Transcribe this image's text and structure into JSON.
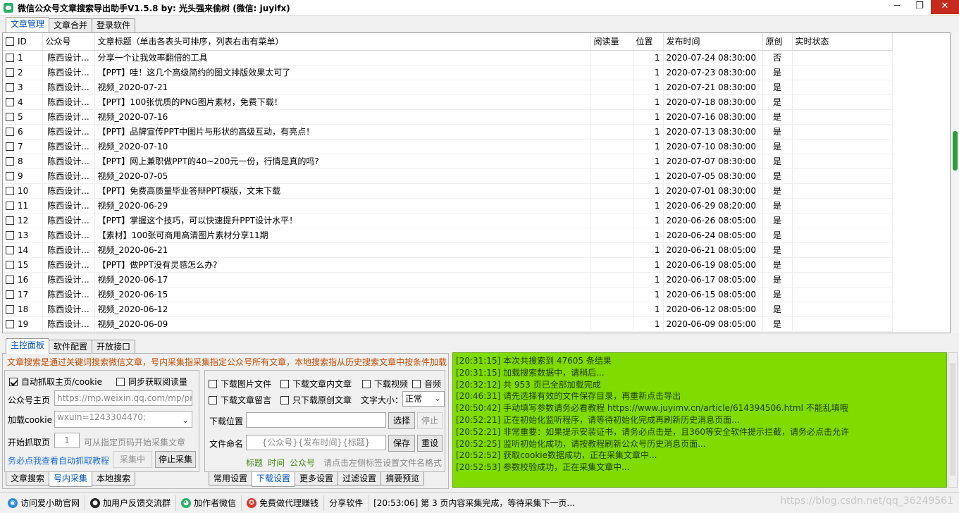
{
  "window": {
    "title": "微信公众号文章搜索导出助手V1.5.8   by:  光头强来偷树  (微信:  juyifx)",
    "minimize": "─",
    "restore": "❐",
    "close": "✕"
  },
  "top_tabs": [
    {
      "label": "文章管理"
    },
    {
      "label": "文章合并"
    },
    {
      "label": "登录软件"
    }
  ],
  "grid": {
    "headers": {
      "id": "ID",
      "account": "公众号",
      "title": "文章标题（单击各表头可排序，列表右击有菜单）",
      "reads": "阅读量",
      "position": "位置",
      "date": "发布时间",
      "original": "原创",
      "status": "实时状态"
    },
    "rows": [
      {
        "id": "1",
        "account": "陈西设计...",
        "title": "分享一个让我效率翻倍的工具",
        "reads": "",
        "position": "1",
        "date": "2020-07-24 08:30:00",
        "original": "否",
        "status": ""
      },
      {
        "id": "2",
        "account": "陈西设计...",
        "title": "【PPT】哇！这几个高级简约的图文排版效果太可了",
        "reads": "",
        "position": "1",
        "date": "2020-07-23 08:30:00",
        "original": "是",
        "status": ""
      },
      {
        "id": "3",
        "account": "陈西设计...",
        "title": "视频_2020-07-21",
        "reads": "",
        "position": "1",
        "date": "2020-07-21 08:30:00",
        "original": "是",
        "status": ""
      },
      {
        "id": "4",
        "account": "陈西设计...",
        "title": "【PPT】100张优质的PNG图片素材，免费下载！",
        "reads": "",
        "position": "1",
        "date": "2020-07-18 08:30:00",
        "original": "是",
        "status": ""
      },
      {
        "id": "5",
        "account": "陈西设计...",
        "title": "视频_2020-07-16",
        "reads": "",
        "position": "1",
        "date": "2020-07-16 08:30:00",
        "original": "是",
        "status": ""
      },
      {
        "id": "6",
        "account": "陈西设计...",
        "title": "【PPT】品牌宣传PPT中图片与形状的高级互动，有亮点！",
        "reads": "",
        "position": "1",
        "date": "2020-07-13 08:30:00",
        "original": "是",
        "status": ""
      },
      {
        "id": "7",
        "account": "陈西设计...",
        "title": "视频_2020-07-10",
        "reads": "",
        "position": "1",
        "date": "2020-07-10 08:30:00",
        "original": "是",
        "status": ""
      },
      {
        "id": "8",
        "account": "陈西设计...",
        "title": "【PPT】网上兼职做PPT的40~200元一份，行情是真的吗?",
        "reads": "",
        "position": "1",
        "date": "2020-07-07 08:30:00",
        "original": "是",
        "status": ""
      },
      {
        "id": "9",
        "account": "陈西设计...",
        "title": "视频_2020-07-05",
        "reads": "",
        "position": "1",
        "date": "2020-07-05 08:30:00",
        "original": "是",
        "status": ""
      },
      {
        "id": "10",
        "account": "陈西设计...",
        "title": "【PPT】免费高质量毕业答辩PPT模版，文末下载",
        "reads": "",
        "position": "1",
        "date": "2020-07-01 08:30:00",
        "original": "是",
        "status": ""
      },
      {
        "id": "11",
        "account": "陈西设计...",
        "title": "视频_2020-06-29",
        "reads": "",
        "position": "1",
        "date": "2020-06-29 08:20:00",
        "original": "是",
        "status": ""
      },
      {
        "id": "12",
        "account": "陈西设计...",
        "title": "【PPT】掌握这个技巧，可以快速提升PPT设计水平！",
        "reads": "",
        "position": "1",
        "date": "2020-06-26 08:05:00",
        "original": "是",
        "status": ""
      },
      {
        "id": "13",
        "account": "陈西设计...",
        "title": "【素材】100张可商用高清图片素材分享11期",
        "reads": "",
        "position": "1",
        "date": "2020-06-24 08:05:00",
        "original": "是",
        "status": ""
      },
      {
        "id": "14",
        "account": "陈西设计...",
        "title": "视频_2020-06-21",
        "reads": "",
        "position": "1",
        "date": "2020-06-21 08:05:00",
        "original": "是",
        "status": ""
      },
      {
        "id": "15",
        "account": "陈西设计...",
        "title": "【PPT】做PPT没有灵感怎么办?",
        "reads": "",
        "position": "1",
        "date": "2020-06-19 08:05:00",
        "original": "是",
        "status": ""
      },
      {
        "id": "16",
        "account": "陈西设计...",
        "title": "视频_2020-06-17",
        "reads": "",
        "position": "1",
        "date": "2020-06-17 08:05:00",
        "original": "是",
        "status": ""
      },
      {
        "id": "17",
        "account": "陈西设计...",
        "title": "视频_2020-06-15",
        "reads": "",
        "position": "1",
        "date": "2020-06-15 08:05:00",
        "original": "是",
        "status": ""
      },
      {
        "id": "18",
        "account": "陈西设计...",
        "title": "视频_2020-06-12",
        "reads": "",
        "position": "1",
        "date": "2020-06-12 08:05:00",
        "original": "是",
        "status": ""
      },
      {
        "id": "19",
        "account": "陈西设计...",
        "title": "视频_2020-06-09",
        "reads": "",
        "position": "1",
        "date": "2020-06-09 08:05:00",
        "original": "是",
        "status": ""
      }
    ]
  },
  "mid_tabs": [
    {
      "label": "主控面板"
    },
    {
      "label": "软件配置"
    },
    {
      "label": "开放接口"
    }
  ],
  "panel": {
    "note": "文章搜索是通过关键词搜索微信文章，号内采集指采集指定公众号所有文章，本地搜索指从历史搜索文章中按条件加载",
    "auto_cookie": "自动抓取主页/cookie",
    "sync_reads": "同步获取阅读量",
    "homepage_label": "公众号主页",
    "homepage_value": "https://mp.weixin.qq.com/mp/profile_ext",
    "cookie_label": "加载cookie",
    "cookie_value": "wxuin=1243304470;",
    "start_page_label": "开始抓取页",
    "start_page_value": "1",
    "start_page_hint": "可从指定页码开始采集文章",
    "tutorial_link": "务必点我查看自动抓取教程",
    "collecting": "采集中",
    "stop_btn": "停止采集",
    "download_images": "下载图片文件",
    "download_inner": "下载文章内文章",
    "download_video": "下载视频",
    "audio": "音频",
    "download_comments": "下载文章留言",
    "original_only": "只下载原创文章",
    "font_size_label": "文字大小：",
    "font_size_value": "正常",
    "download_pos_label": "下载位置",
    "select_btn": "选择",
    "stop_small": "停止",
    "file_naming_label": "文件命名",
    "file_naming_value": "{公众号}{发布时间}{标题}",
    "save_btn": "保存",
    "reset_btn": "重设",
    "tag_title": "标题",
    "tag_time": "时间",
    "tag_account": "公众号",
    "tag_hint": "请点击左侧标签设置文件名格式"
  },
  "left_bottom_tabs": [
    {
      "label": "文章搜索"
    },
    {
      "label": "号内采集"
    },
    {
      "label": "本地搜索"
    }
  ],
  "right_bottom_tabs": [
    {
      "label": "常用设置"
    },
    {
      "label": "下载设置"
    },
    {
      "label": "更多设置"
    },
    {
      "label": "过滤设置"
    },
    {
      "label": "摘要预览"
    }
  ],
  "log": [
    "[20:31:15] 本次共搜索到 47605 条结果",
    "[20:31:15] 加载搜索数据中，请稍后...",
    "[20:32:12] 共 953 页已全部加载完成",
    "[20:46:31] 请先选择有效的文件保存目录，再重新点击导出",
    "[20:50:42] 手动填写参数请务必看教程 https://www.juyimv.cn/article/614394506.html 不能乱填哦",
    "[20:52:21] 正在初始化监听程序，请等待初始化完成再刷新历史消息页面...",
    "[20:52:21] 非常重要：如果提示安装证书，请务必点击是，且360等安全软件提示拦截，请务必点击允许",
    "[20:52:25] 监听初始化成功，请按教程刷新公众号历史消息页面...",
    "[20:52:52] 获取cookie数据成功，正在采集文章中...",
    "[20:52:53] 参数校验成功，正在采集文章中..."
  ],
  "statusbar": {
    "site": "访问爱小助官网",
    "group": "加用户反馈交流群",
    "wechat": "加作者微信",
    "agent": "免费做代理赚钱",
    "share": "分享软件",
    "status": "[20:53:06] 第 3 页内容采集完成，等待采集下一页..."
  },
  "watermark": "https://blog.csdn.net/qq_36249561"
}
